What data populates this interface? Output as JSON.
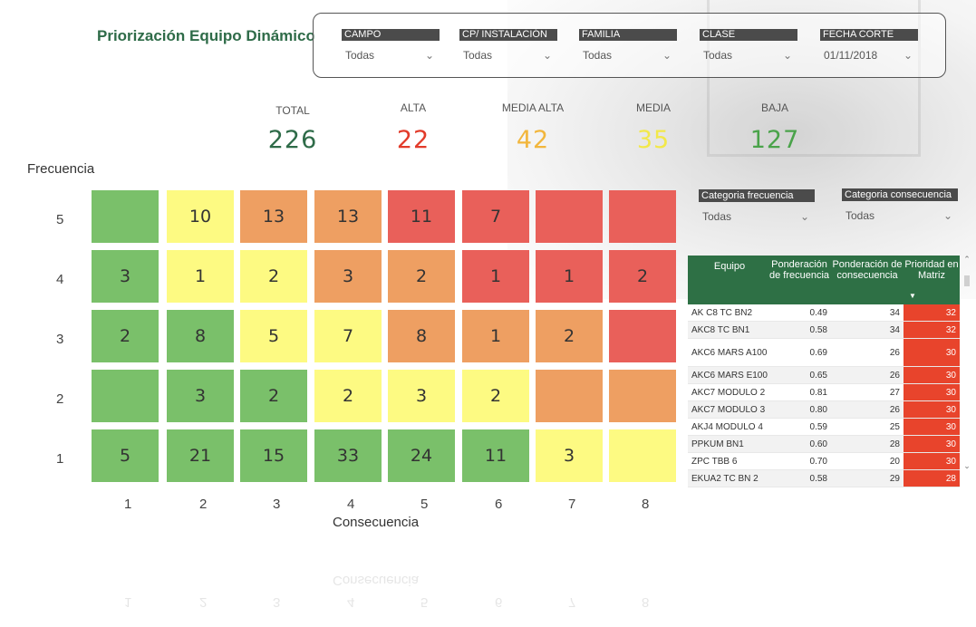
{
  "title": "Priorización Equipo Dinámico",
  "filters": [
    {
      "label": "CAMPO",
      "value": "Todas"
    },
    {
      "label": "CP/ INSTALACIÓN",
      "value": "Todas"
    },
    {
      "label": "FAMILIA",
      "value": "Todas"
    },
    {
      "label": "CLASE",
      "value": "Todas"
    },
    {
      "label": "FECHA CORTE",
      "value": "01/11/2018"
    }
  ],
  "kpis": [
    {
      "label": "TOTAL",
      "value": "226",
      "color": "#2e6b48"
    },
    {
      "label": "ALTA",
      "value": "22",
      "color": "#e23b2a"
    },
    {
      "label": "MEDIA ALTA",
      "value": "42",
      "color": "#f2b63c"
    },
    {
      "label": "MEDIA",
      "value": "35",
      "color": "#f2e84a"
    },
    {
      "label": "BAJA",
      "value": "127",
      "color": "#4aa34a"
    }
  ],
  "matrix": {
    "y_title": "Frecuencia",
    "x_title": "Consecuencia",
    "row_labels": [
      "5",
      "4",
      "3",
      "2",
      "1"
    ],
    "col_labels": [
      "1",
      "2",
      "3",
      "4",
      "5",
      "6",
      "7",
      "8"
    ],
    "colors": {
      "green": "#7ac06a",
      "yellow": "#fdfa82",
      "orange": "#ee9f62",
      "red": "#e9605a"
    },
    "rows": [
      [
        {
          "v": "",
          "c": "green"
        },
        {
          "v": "10",
          "c": "yellow"
        },
        {
          "v": "13",
          "c": "orange"
        },
        {
          "v": "13",
          "c": "orange"
        },
        {
          "v": "11",
          "c": "red"
        },
        {
          "v": "7",
          "c": "red"
        },
        {
          "v": "",
          "c": "red"
        },
        {
          "v": "",
          "c": "red"
        }
      ],
      [
        {
          "v": "3",
          "c": "green"
        },
        {
          "v": "1",
          "c": "yellow"
        },
        {
          "v": "2",
          "c": "yellow"
        },
        {
          "v": "3",
          "c": "orange"
        },
        {
          "v": "2",
          "c": "orange"
        },
        {
          "v": "1",
          "c": "red"
        },
        {
          "v": "1",
          "c": "red"
        },
        {
          "v": "2",
          "c": "red"
        }
      ],
      [
        {
          "v": "2",
          "c": "green"
        },
        {
          "v": "8",
          "c": "green"
        },
        {
          "v": "5",
          "c": "yellow"
        },
        {
          "v": "7",
          "c": "yellow"
        },
        {
          "v": "8",
          "c": "orange"
        },
        {
          "v": "1",
          "c": "orange"
        },
        {
          "v": "2",
          "c": "orange"
        },
        {
          "v": "",
          "c": "red"
        }
      ],
      [
        {
          "v": "",
          "c": "green"
        },
        {
          "v": "3",
          "c": "green"
        },
        {
          "v": "2",
          "c": "green"
        },
        {
          "v": "2",
          "c": "yellow"
        },
        {
          "v": "3",
          "c": "yellow"
        },
        {
          "v": "2",
          "c": "yellow"
        },
        {
          "v": "",
          "c": "orange"
        },
        {
          "v": "",
          "c": "orange"
        }
      ],
      [
        {
          "v": "5",
          "c": "green"
        },
        {
          "v": "21",
          "c": "green"
        },
        {
          "v": "15",
          "c": "green"
        },
        {
          "v": "33",
          "c": "green"
        },
        {
          "v": "24",
          "c": "green"
        },
        {
          "v": "11",
          "c": "green"
        },
        {
          "v": "3",
          "c": "yellow"
        },
        {
          "v": "",
          "c": "yellow"
        }
      ]
    ]
  },
  "side_filters": [
    {
      "label": "Categoria frecuencia",
      "value": "Todas"
    },
    {
      "label": "Categoria consecuencia",
      "value": "Todas"
    }
  ],
  "table": {
    "headers": [
      "Equipo",
      "Ponderación de frecuencia",
      "Ponderación de consecuencia",
      "Prioridad en Matriz"
    ],
    "rows": [
      [
        "AK C8 TC BN2",
        "0.49",
        "34",
        "32"
      ],
      [
        "AKC8 TC BN1",
        "0.58",
        "34",
        "32"
      ],
      [
        "AKC6 MARS A100",
        "0.69",
        "26",
        "30"
      ],
      [
        "AKC6 MARS E100",
        "0.65",
        "26",
        "30"
      ],
      [
        "AKC7 MODULO 2",
        "0.81",
        "27",
        "30"
      ],
      [
        "AKC7 MODULO 3",
        "0.80",
        "26",
        "30"
      ],
      [
        "AKJ4 MODULO 4",
        "0.59",
        "25",
        "30"
      ],
      [
        "PPKUM BN1",
        "0.60",
        "28",
        "30"
      ],
      [
        "ZPC TBB 6",
        "0.70",
        "20",
        "30"
      ],
      [
        "EKUA2 TC BN 2",
        "0.58",
        "29",
        "28"
      ]
    ]
  }
}
